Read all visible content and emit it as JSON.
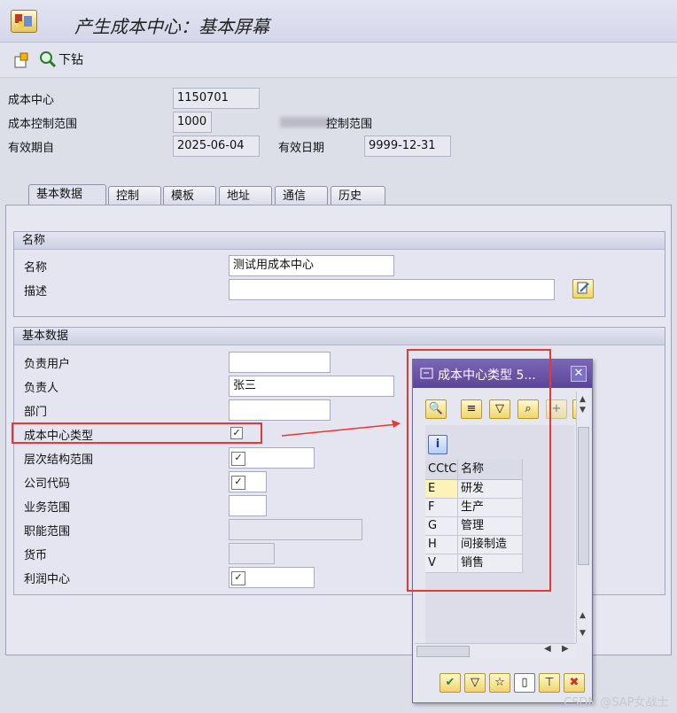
{
  "window": {
    "title": "产生成本中心：基本屏幕"
  },
  "toolbar": {
    "drilldown_label": "下钻"
  },
  "header": {
    "cost_center_label": "成本中心",
    "cost_center_value": "1150701",
    "controlling_area_label": "成本控制范围",
    "controlling_area_value": "1000",
    "controlling_area_desc": "控制范围",
    "valid_from_label": "有效期自",
    "valid_from_value": "2025-06-04",
    "valid_to_label": "有效日期",
    "valid_to_value": "9999-12-31"
  },
  "tabs": [
    {
      "label": "基本数据",
      "active": true
    },
    {
      "label": "控制"
    },
    {
      "label": "模板"
    },
    {
      "label": "地址"
    },
    {
      "label": "通信"
    },
    {
      "label": "历史"
    }
  ],
  "names_group": {
    "title": "名称",
    "name_label": "名称",
    "name_value": "测试用成本中心",
    "desc_label": "描述",
    "desc_value": ""
  },
  "basic_group": {
    "title": "基本数据",
    "user_label": "负责用户",
    "person_label": "负责人",
    "person_value": "张三",
    "dept_label": "部门",
    "cc_type_label": "成本中心类型",
    "hierarchy_label": "层次结构范围",
    "company_label": "公司代码",
    "business_area_label": "业务范围",
    "functional_area_label": "职能范围",
    "currency_label": "货币",
    "profit_center_label": "利润中心"
  },
  "popup": {
    "title": "成本中心类型 5...",
    "col_code": "CCtC",
    "col_name": "名称",
    "rows": [
      {
        "code": "E",
        "name": "研发"
      },
      {
        "code": "F",
        "name": "生产"
      },
      {
        "code": "G",
        "name": "管理"
      },
      {
        "code": "H",
        "name": "间接制造"
      },
      {
        "code": "V",
        "name": "销售"
      }
    ]
  },
  "watermark": "CSDN @SAP女战士",
  "colors": {
    "highlight": "#e53935",
    "popup_header": "#5a4597"
  }
}
